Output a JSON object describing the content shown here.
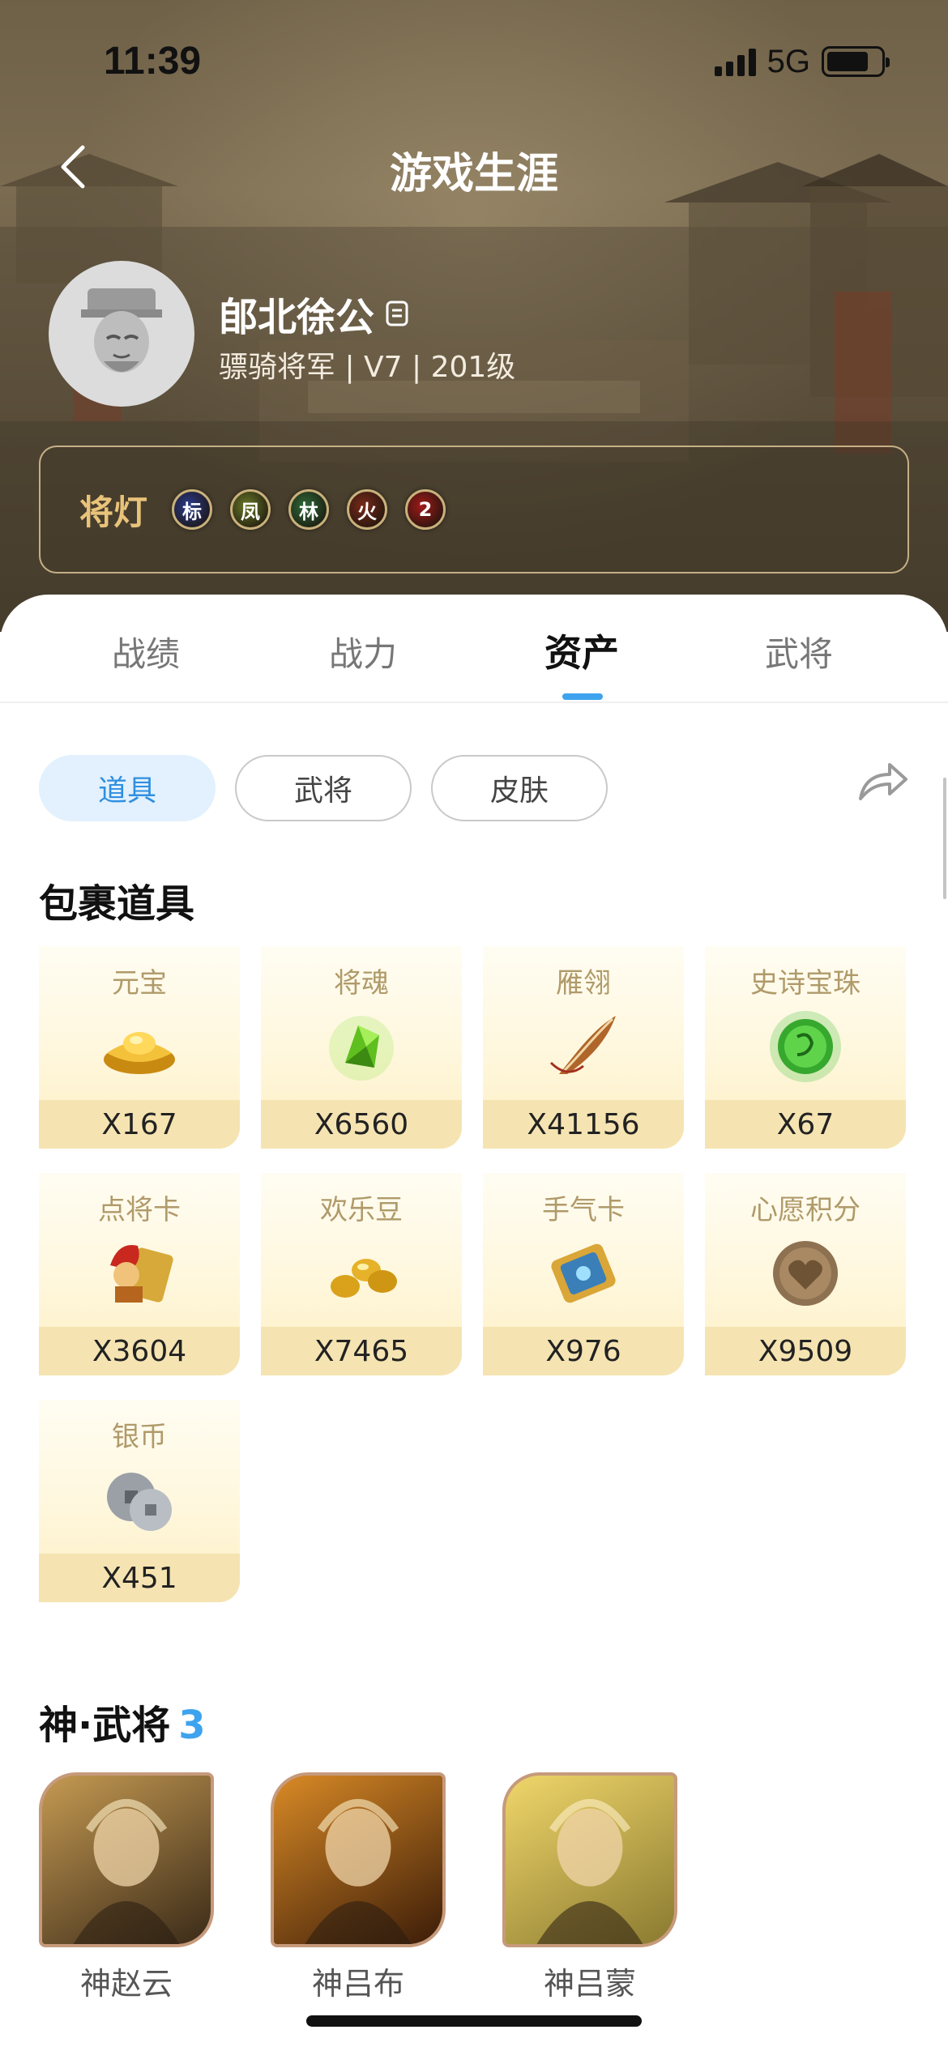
{
  "status_bar": {
    "time": "11:39",
    "network": "5G"
  },
  "nav": {
    "title": "游戏生涯"
  },
  "profile": {
    "name": "郋北徐公",
    "subtitle": "骠骑将军 | V7 | 201级"
  },
  "lamps": {
    "label": "将灯",
    "badges": [
      {
        "text": "标",
        "color": "#2b3a8c"
      },
      {
        "text": "凤",
        "color": "#6a7a2a"
      },
      {
        "text": "林",
        "color": "#2e6a3a"
      },
      {
        "text": "火",
        "color": "#7a2a1a"
      },
      {
        "text": "2",
        "color": "#a01a1a"
      }
    ]
  },
  "tabs": [
    {
      "label": "战绩",
      "active": false
    },
    {
      "label": "战力",
      "active": false
    },
    {
      "label": "资产",
      "active": true
    },
    {
      "label": "武将",
      "active": false
    }
  ],
  "filters": [
    {
      "label": "道具",
      "active": true
    },
    {
      "label": "武将",
      "active": false
    },
    {
      "label": "皮肤",
      "active": false
    }
  ],
  "bag": {
    "title": "包裹道具",
    "items": [
      {
        "name": "元宝",
        "count": "X167",
        "icon": "gold-ingot-icon"
      },
      {
        "name": "将魂",
        "count": "X6560",
        "icon": "green-crystal-icon"
      },
      {
        "name": "雁翎",
        "count": "X41156",
        "icon": "feather-icon"
      },
      {
        "name": "史诗宝珠",
        "count": "X67",
        "icon": "green-orb-icon"
      },
      {
        "name": "点将卡",
        "count": "X3604",
        "icon": "general-card-icon"
      },
      {
        "name": "欢乐豆",
        "count": "X7465",
        "icon": "golden-beans-icon"
      },
      {
        "name": "手气卡",
        "count": "X976",
        "icon": "luck-card-icon"
      },
      {
        "name": "心愿积分",
        "count": "X9509",
        "icon": "heart-coin-icon"
      },
      {
        "name": "银币",
        "count": "X451",
        "icon": "silver-coins-icon"
      }
    ]
  },
  "god_generals": {
    "title": "神·武将",
    "count": "3",
    "heroes": [
      {
        "name": "神赵云",
        "icon": "zhao-yun-portrait-icon",
        "colors": [
          "#3a2a18",
          "#c59a52"
        ]
      },
      {
        "name": "神吕布",
        "icon": "lv-bu-portrait-icon",
        "colors": [
          "#3b1c08",
          "#d98a26"
        ]
      },
      {
        "name": "神吕蒙",
        "icon": "lv-meng-portrait-icon",
        "colors": [
          "#8a7a30",
          "#f0d66a"
        ]
      }
    ]
  },
  "colors": {
    "accent": "#3ea3ee",
    "gold": "#e8c37a"
  }
}
